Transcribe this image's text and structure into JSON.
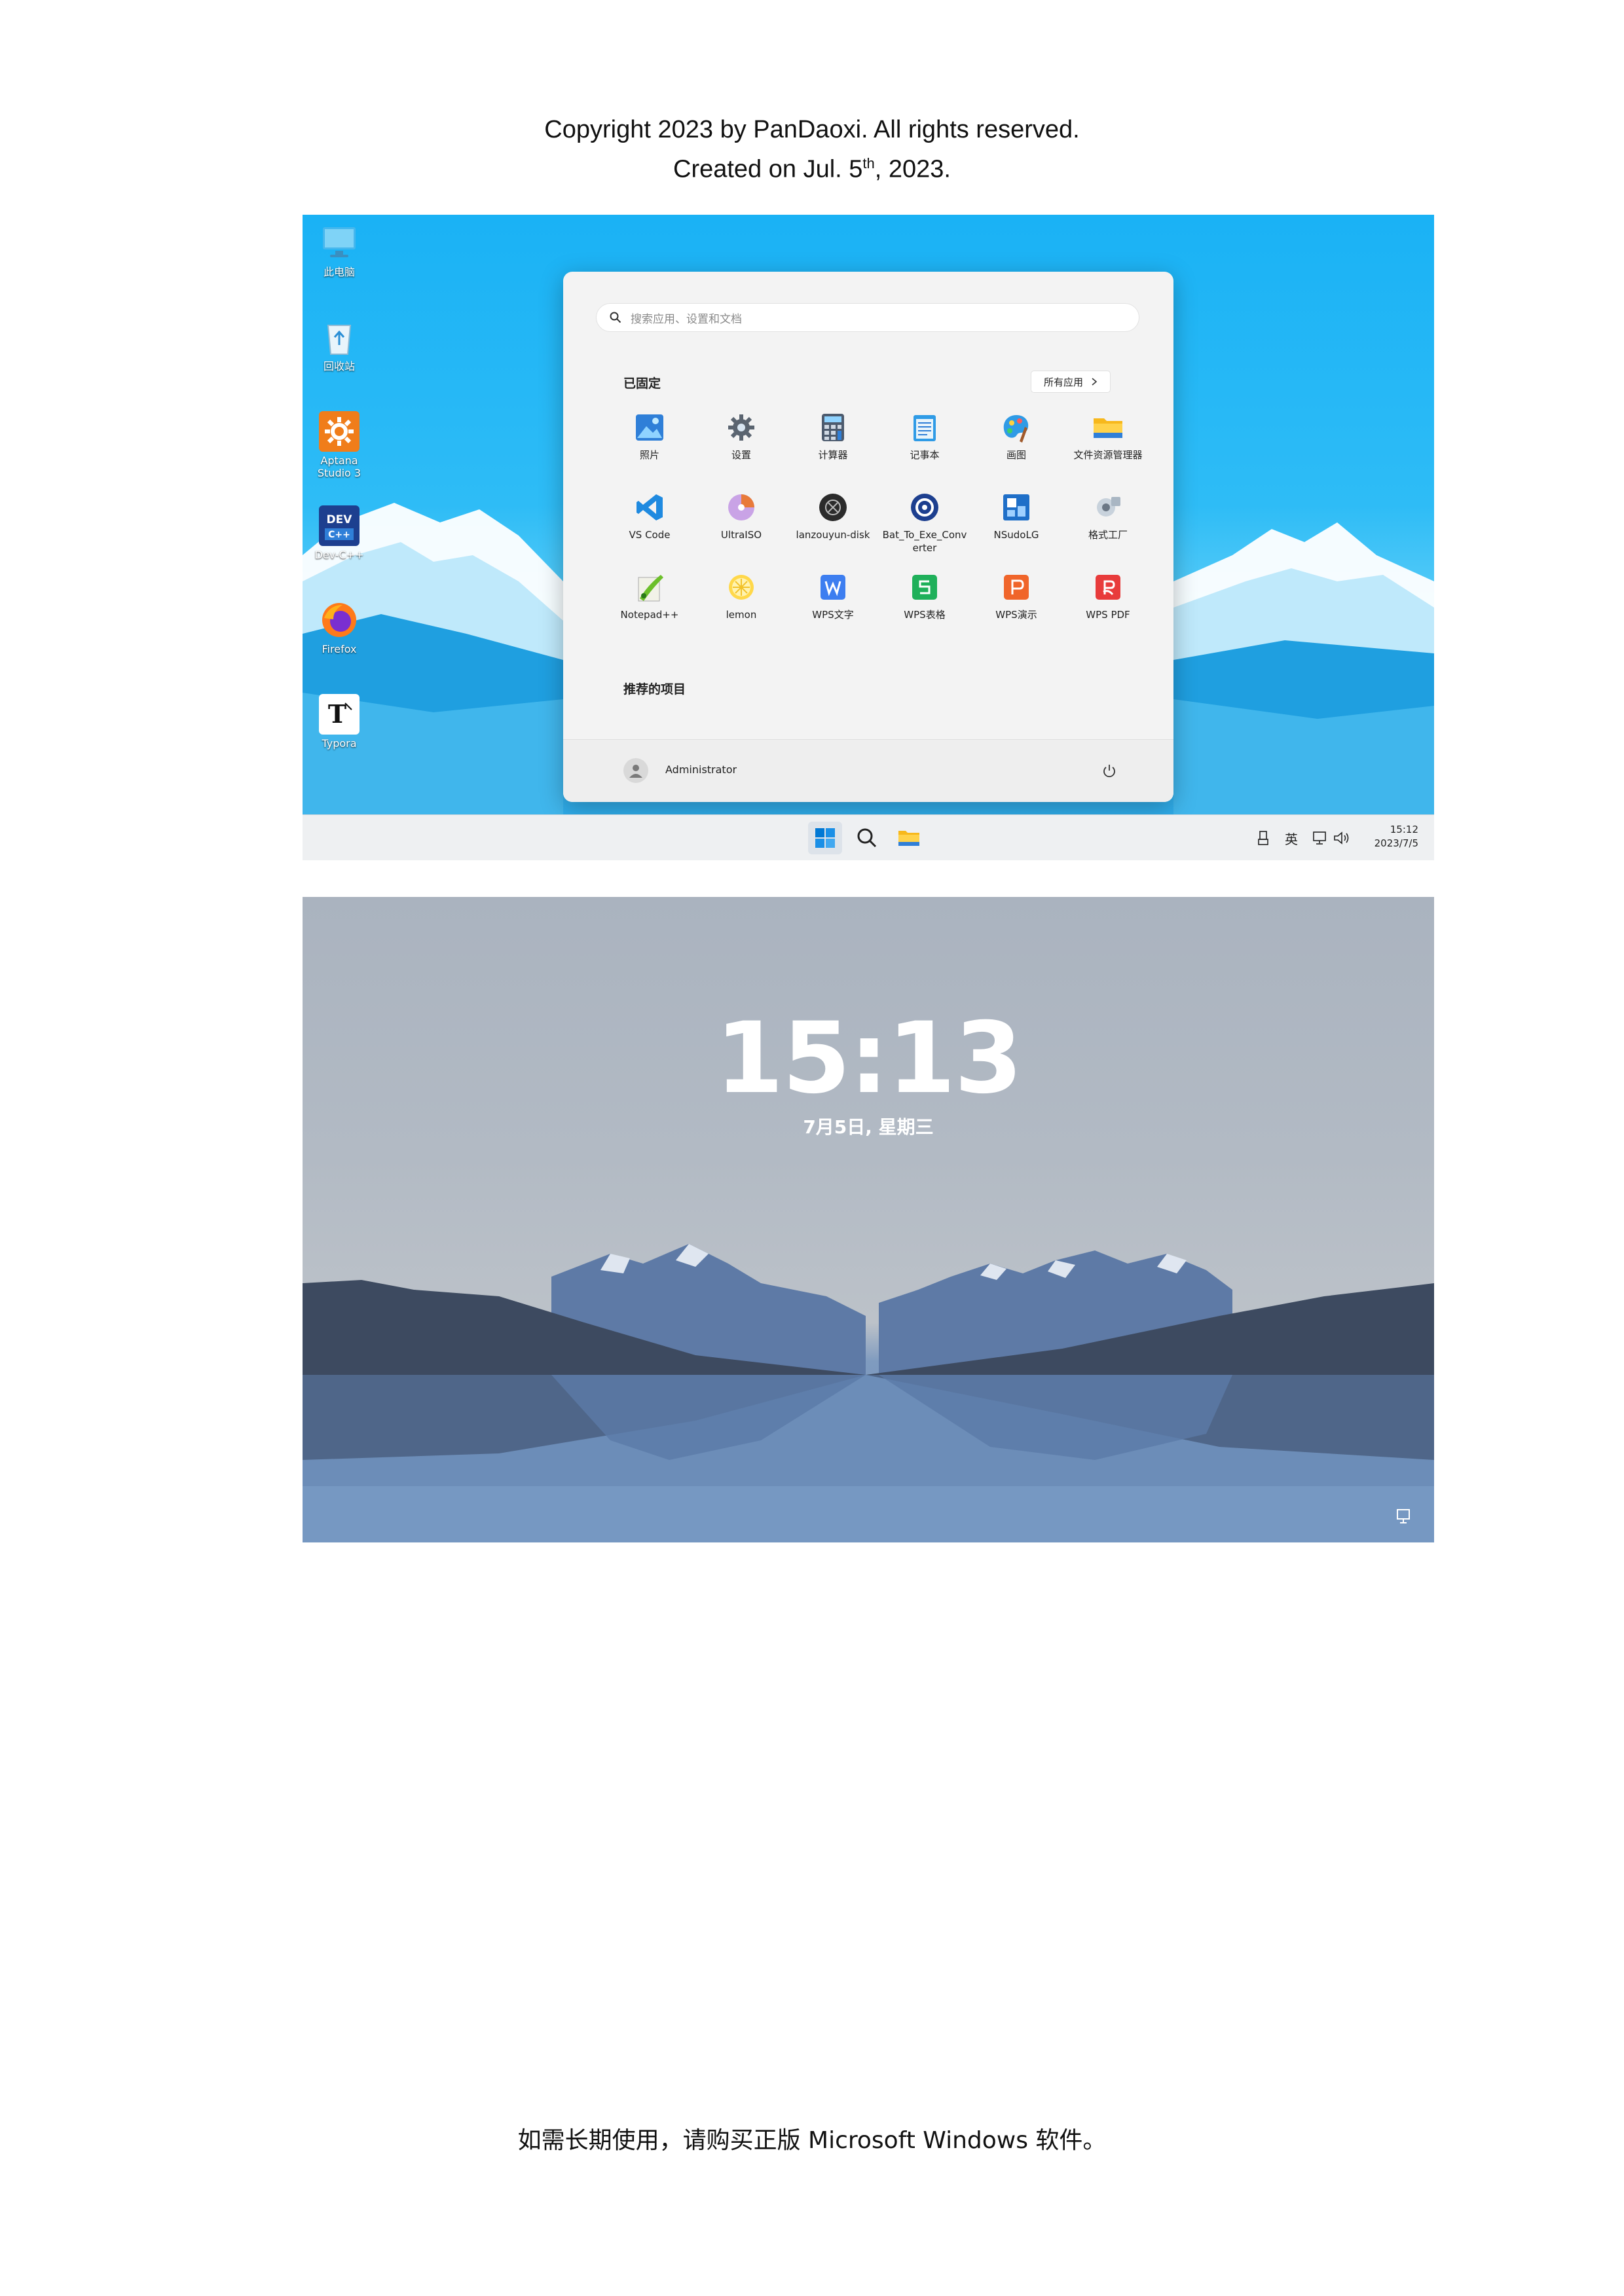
{
  "document": {
    "header_line1": "Copyright 2023 by PanDaoxi. All rights reserved.",
    "header_line2_prefix": "Created on Jul. 5",
    "header_line2_sup": "th",
    "header_line2_suffix": ", 2023.",
    "footer_notice": "如需长期使用，请购买正版 Microsoft Windows 软件。"
  },
  "desktop": {
    "icons": [
      {
        "label": "此电脑",
        "icon": "computer-icon"
      },
      {
        "label": "回收站",
        "icon": "recycle-bin-icon"
      },
      {
        "label": "Aptana Studio 3",
        "icon": "aptana-icon"
      },
      {
        "label": "Dev-C++",
        "icon": "devcpp-icon"
      },
      {
        "label": "Firefox",
        "icon": "firefox-icon"
      },
      {
        "label": "Typora",
        "icon": "typora-icon"
      }
    ],
    "start_menu": {
      "search_placeholder": "搜索应用、设置和文档",
      "pinned_title": "已固定",
      "all_apps_label": "所有应用",
      "pinned_apps": [
        {
          "label": "照片",
          "icon": "photos-icon"
        },
        {
          "label": "设置",
          "icon": "settings-gear-icon"
        },
        {
          "label": "计算器",
          "icon": "calculator-icon"
        },
        {
          "label": "记事本",
          "icon": "notepad-icon"
        },
        {
          "label": "画图",
          "icon": "paint-icon"
        },
        {
          "label": "文件资源管理器",
          "icon": "file-explorer-icon"
        },
        {
          "label": "VS Code",
          "icon": "vscode-icon"
        },
        {
          "label": "UltraISO",
          "icon": "ultraiso-icon"
        },
        {
          "label": "lanzouyun-disk",
          "icon": "lanzouyun-icon"
        },
        {
          "label": "Bat_To_Exe_Conv\nerter",
          "icon": "bat-to-exe-icon"
        },
        {
          "label": "NSudoLG",
          "icon": "nsudo-icon"
        },
        {
          "label": "格式工厂",
          "icon": "format-factory-icon"
        },
        {
          "label": "Notepad++",
          "icon": "notepadpp-icon"
        },
        {
          "label": "lemon",
          "icon": "lemon-icon"
        },
        {
          "label": "WPS文字",
          "icon": "wps-writer-icon"
        },
        {
          "label": "WPS表格",
          "icon": "wps-spreadsheet-icon"
        },
        {
          "label": "WPS演示",
          "icon": "wps-presentation-icon"
        },
        {
          "label": "WPS PDF",
          "icon": "wps-pdf-icon"
        }
      ],
      "recommended_title": "推荐的项目",
      "user_name": "Administrator"
    },
    "taskbar": {
      "tray_ime": "英",
      "clock_time": "15:12",
      "clock_date": "2023/7/5"
    },
    "colors": {
      "accent": "#0078d4",
      "wallpaper_sky": "#1ab2f5",
      "start_bg": "#f3f3f3"
    }
  },
  "lockscreen": {
    "time": "15:13",
    "date": "7月5日, 星期三",
    "colors": {
      "sky": "#aab3bf",
      "water": "#6c8db8"
    }
  }
}
